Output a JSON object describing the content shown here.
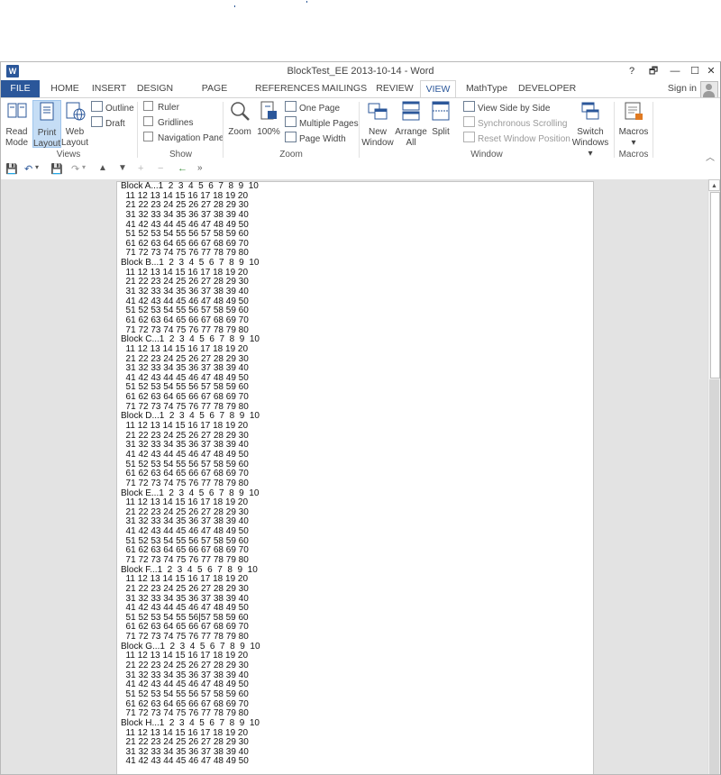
{
  "window": {
    "title": "BlockTest_EE 2013-10-14 - Word",
    "app_icon": "W",
    "controls": {
      "help": "?",
      "ribbon_display": "🗗",
      "minimize": "—",
      "maximize": "☐",
      "close": "✕"
    }
  },
  "tabs": [
    {
      "label": "FILE"
    },
    {
      "label": "HOME"
    },
    {
      "label": "INSERT"
    },
    {
      "label": "DESIGN"
    },
    {
      "label": "PAGE LAYOUT"
    },
    {
      "label": "REFERENCES"
    },
    {
      "label": "MAILINGS"
    },
    {
      "label": "REVIEW"
    },
    {
      "label": "VIEW",
      "active": true
    },
    {
      "label": "MathType"
    },
    {
      "label": "DEVELOPER"
    }
  ],
  "signin": "Sign in",
  "ribbon": {
    "views": {
      "label": "Views",
      "read_mode": [
        "Read",
        "Mode"
      ],
      "print_layout": [
        "Print",
        "Layout"
      ],
      "web_layout": [
        "Web",
        "Layout"
      ],
      "outline": "Outline",
      "draft": "Draft"
    },
    "show": {
      "label": "Show",
      "ruler": "Ruler",
      "gridlines": "Gridlines",
      "navigation_pane": "Navigation Pane"
    },
    "zoom": {
      "label": "Zoom",
      "zoom": "Zoom",
      "hundred": "100%",
      "one_page": "One Page",
      "multiple_pages": "Multiple Pages",
      "page_width": "Page Width"
    },
    "window": {
      "label": "Window",
      "new_window": [
        "New",
        "Window"
      ],
      "arrange_all": [
        "Arrange",
        "All"
      ],
      "split": "Split",
      "view_side_by_side": "View Side by Side",
      "synchronous_scrolling": "Synchronous Scrolling",
      "reset_window_position": "Reset Window Position",
      "switch_windows": [
        "Switch",
        "Windows ▾"
      ]
    },
    "macros": {
      "label": "Macros",
      "macros": "Macros",
      "dropdown": "▾"
    }
  },
  "qat": {
    "save": "💾",
    "undo": "↶",
    "redo": "↷"
  },
  "document": {
    "blocks": [
      "A",
      "B",
      "C",
      "D",
      "E",
      "F",
      "G",
      "H"
    ],
    "block_prefix": "Block ",
    "block_suffix": "... ",
    "lines_rendered": 61,
    "cursor_marker": "F:51 52 53 54 55 56|57 58 59 60"
  }
}
